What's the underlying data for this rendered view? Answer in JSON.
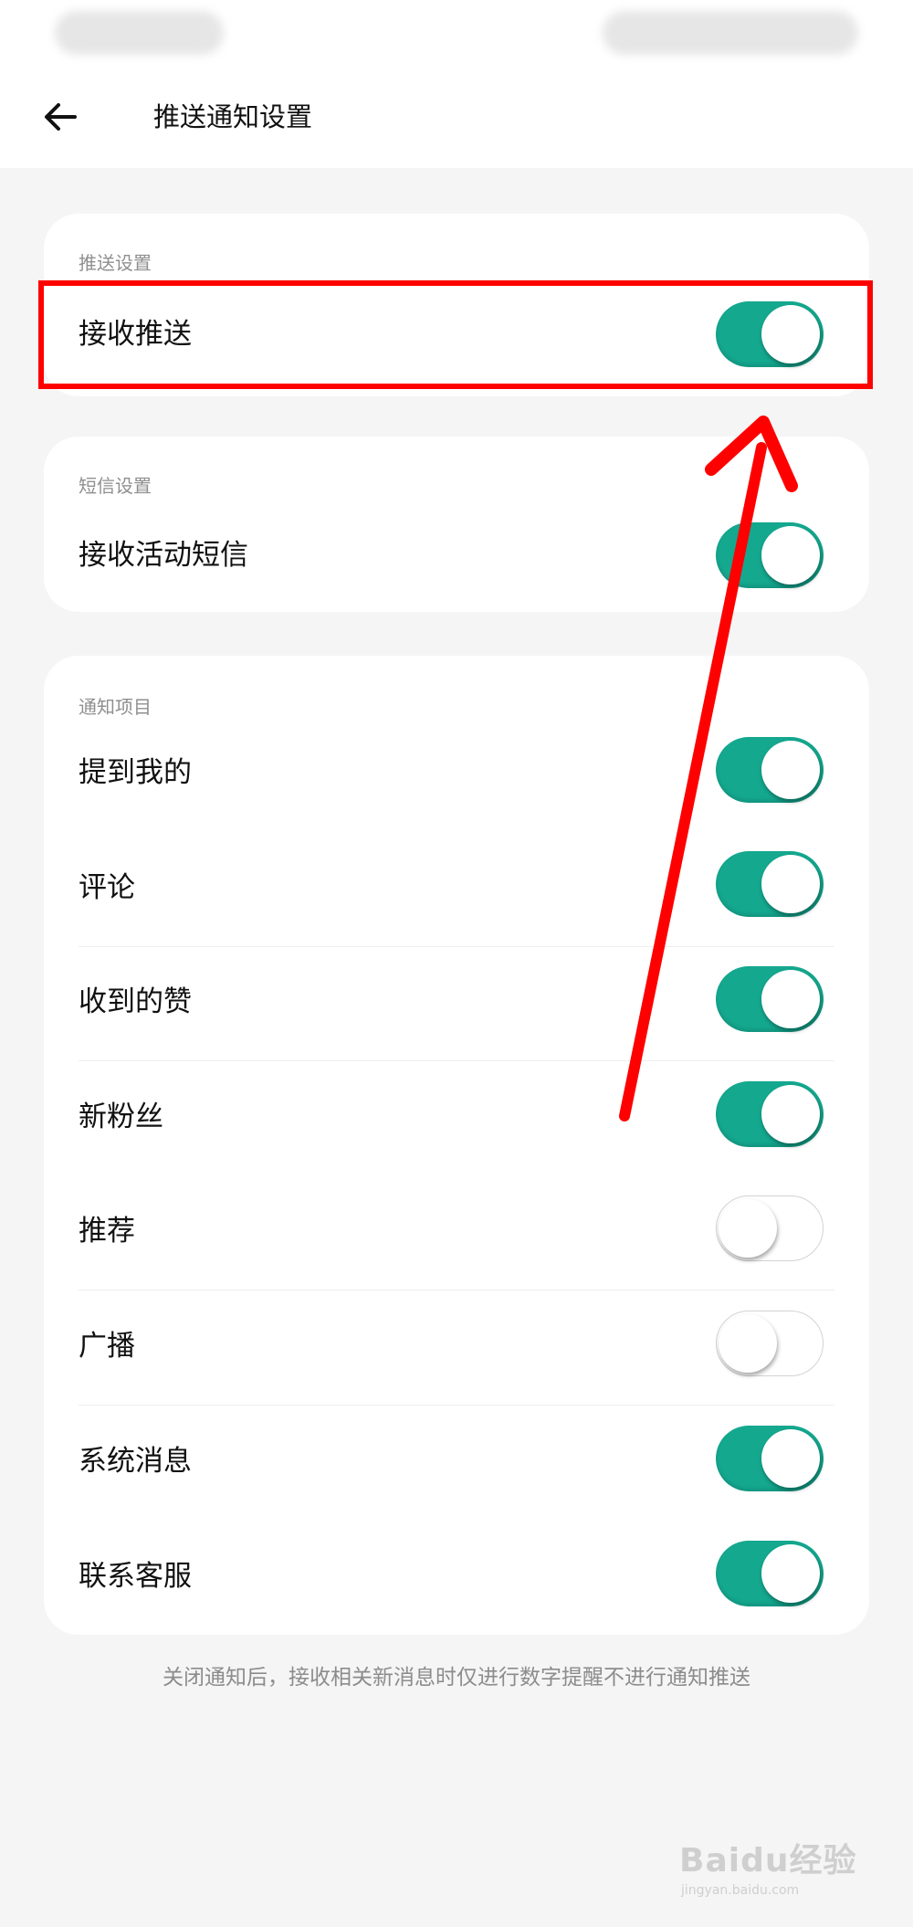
{
  "header": {
    "title": "推送通知设置"
  },
  "push_settings": {
    "section_label": "推送设置",
    "items": [
      {
        "label": "接收推送",
        "on": true
      }
    ]
  },
  "sms_settings": {
    "section_label": "短信设置",
    "items": [
      {
        "label": "接收活动短信",
        "on": true
      }
    ]
  },
  "notification_items": {
    "section_label": "通知项目",
    "items": [
      {
        "label": "提到我的",
        "on": true
      },
      {
        "label": "评论",
        "on": true
      },
      {
        "label": "收到的赞",
        "on": true
      },
      {
        "label": "新粉丝",
        "on": true
      },
      {
        "label": "推荐",
        "on": false
      },
      {
        "label": "广播",
        "on": false
      },
      {
        "label": "系统消息",
        "on": true
      },
      {
        "label": "联系客服",
        "on": true
      }
    ]
  },
  "footnote": "关闭通知后，接收相关新消息时仅进行数字提醒不进行通知推送",
  "watermark": {
    "brand": "Baidu经验",
    "sub": "jingyan.baidu.com"
  },
  "colors": {
    "toggle_on": "#14a88f",
    "annotation": "#ff0000",
    "background": "#f5f5f5"
  },
  "icons": {
    "back": "arrow-left-icon"
  }
}
